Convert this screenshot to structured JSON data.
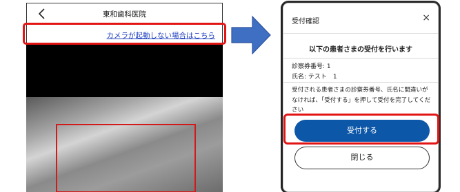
{
  "phone": {
    "title": "東和歯科医院",
    "camera_link": "カメラが起動しない場合はこちら"
  },
  "modal": {
    "title": "受付確認",
    "close_symbol": "×",
    "lead": "以下の患者さまの受付を行います",
    "card_number_line": "診察券番号: 1",
    "name_line": "氏名: テスト　1",
    "notice": "受付される患者さまの診察券番号、氏名に間違いがなければ、「受付する」を押して受付を完了してください",
    "accept_button": "受付する",
    "close_button": "閉じる"
  },
  "colors": {
    "accent_blue": "#0d57a8",
    "highlight_red": "#e21414",
    "arrow_blue": "#3f6fc2",
    "link_blue": "#1f3fbf"
  },
  "icons": {
    "back": "chevron-left-icon",
    "close": "close-icon",
    "arrow": "right-arrow-icon"
  }
}
